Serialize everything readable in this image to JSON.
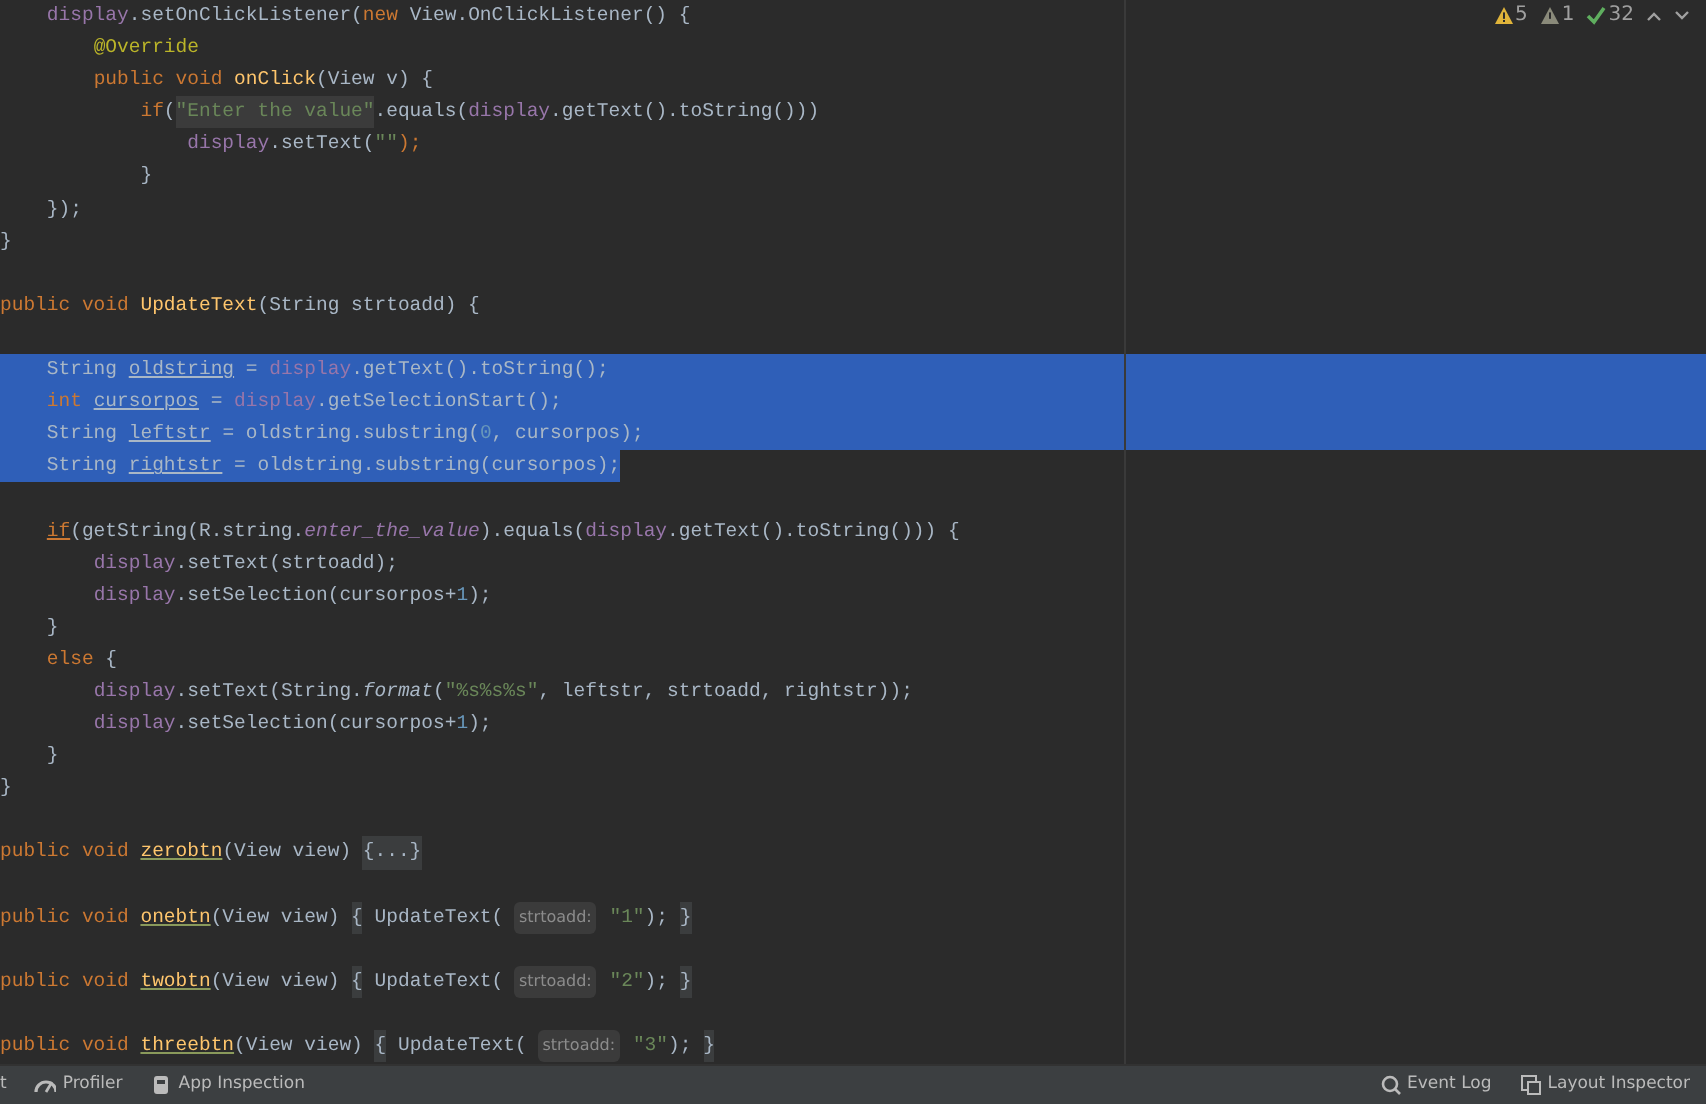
{
  "inspections": [
    {
      "kind": "warning",
      "count": "5"
    },
    {
      "kind": "weak-warning",
      "count": "1"
    },
    {
      "kind": "typo",
      "count": "32"
    }
  ],
  "lines": [
    {
      "selected": false,
      "tokens": [
        {
          "kind": "field",
          "text": "    display"
        },
        {
          "kind": "plain",
          "text": ".setOnClickListener("
        },
        {
          "kind": "keyword",
          "text": "new "
        },
        {
          "kind": "plain",
          "text": "View.OnClickListener() {"
        }
      ]
    },
    {
      "selected": false,
      "tokens": [
        {
          "kind": "annotation",
          "text": "        @Override"
        }
      ]
    },
    {
      "selected": false,
      "tokens": [
        {
          "kind": "keyword",
          "text": "        public void "
        },
        {
          "kind": "method-decl",
          "text": "onClick"
        },
        {
          "kind": "plain",
          "text": "(View v) {"
        }
      ]
    },
    {
      "selected": false,
      "tokens": [
        {
          "kind": "keyword",
          "text": "            if"
        },
        {
          "kind": "plain",
          "text": "("
        },
        {
          "kind": "string-marked",
          "text": "\"Enter the value\""
        },
        {
          "kind": "plain",
          "text": ".equals("
        },
        {
          "kind": "field",
          "text": "display"
        },
        {
          "kind": "plain",
          "text": ".getText().toString()))"
        }
      ]
    },
    {
      "selected": false,
      "tokens": [
        {
          "kind": "field",
          "text": "                display"
        },
        {
          "kind": "plain",
          "text": ".setText("
        },
        {
          "kind": "string",
          "text": "\"\""
        },
        {
          "kind": "punct",
          "text": ");"
        }
      ]
    },
    {
      "selected": false,
      "tokens": [
        {
          "kind": "plain",
          "text": "            }"
        }
      ]
    },
    {
      "selected": false,
      "tokens": [
        {
          "kind": "plain",
          "text": "    });"
        }
      ]
    },
    {
      "selected": false,
      "tokens": [
        {
          "kind": "plain",
          "text": "}"
        }
      ]
    },
    {
      "selected": false
    },
    {
      "selected": false,
      "tokens": [
        {
          "kind": "keyword",
          "text": "public void "
        },
        {
          "kind": "method-decl",
          "text": "UpdateText"
        },
        {
          "kind": "plain",
          "text": "(String strtoadd) {"
        }
      ]
    },
    {
      "selected": false
    },
    {
      "selected": true,
      "tokens": [
        {
          "kind": "plain",
          "text": "    String "
        },
        {
          "kind": "var-decl",
          "text": "oldstring"
        },
        {
          "kind": "plain",
          "text": " = "
        },
        {
          "kind": "field",
          "text": "display"
        },
        {
          "kind": "plain",
          "text": ".getText().toString();"
        }
      ]
    },
    {
      "selected": true,
      "tokens": [
        {
          "kind": "keyword",
          "text": "    int "
        },
        {
          "kind": "var-decl",
          "text": "cursorpos"
        },
        {
          "kind": "plain",
          "text": " = "
        },
        {
          "kind": "field",
          "text": "display"
        },
        {
          "kind": "plain",
          "text": ".getSelectionStart();"
        }
      ]
    },
    {
      "selected": true,
      "tokens": [
        {
          "kind": "plain",
          "text": "    String "
        },
        {
          "kind": "var-decl",
          "text": "leftstr"
        },
        {
          "kind": "plain",
          "text": " = oldstring.substring("
        },
        {
          "kind": "number",
          "text": "0"
        },
        {
          "kind": "plain",
          "text": ", cursorpos);"
        }
      ]
    },
    {
      "selected": true,
      "tokens": [
        {
          "kind": "plain",
          "text": "    String "
        },
        {
          "kind": "var-decl",
          "text": "rightstr"
        },
        {
          "kind": "plain",
          "text": " = oldstring.substring(cursorpos);"
        }
      ]
    },
    {
      "selected": false
    },
    {
      "selected": false,
      "tokens": [
        {
          "kind": "keyword-flagged",
          "text": "    if"
        },
        {
          "kind": "plain",
          "text": "(getString(R.string."
        },
        {
          "kind": "static-field",
          "text": "enter_the_value"
        },
        {
          "kind": "plain",
          "text": ").equals("
        },
        {
          "kind": "field",
          "text": "display"
        },
        {
          "kind": "plain",
          "text": ".getText().toString())) {"
        }
      ]
    },
    {
      "selected": false,
      "tokens": [
        {
          "kind": "field",
          "text": "        display"
        },
        {
          "kind": "plain",
          "text": ".setText(strtoadd);"
        }
      ]
    },
    {
      "selected": false,
      "tokens": [
        {
          "kind": "field",
          "text": "        display"
        },
        {
          "kind": "plain",
          "text": ".setSelection(cursorpos+"
        },
        {
          "kind": "number",
          "text": "1"
        },
        {
          "kind": "plain",
          "text": ");"
        }
      ]
    },
    {
      "selected": false,
      "tokens": [
        {
          "kind": "plain",
          "text": "    }"
        }
      ]
    },
    {
      "selected": false,
      "tokens": [
        {
          "kind": "keyword",
          "text": "    else "
        },
        {
          "kind": "plain",
          "text": "{"
        }
      ]
    },
    {
      "selected": false,
      "tokens": [
        {
          "kind": "field",
          "text": "        display"
        },
        {
          "kind": "plain",
          "text": ".setText(String."
        },
        {
          "kind": "static-method",
          "text": "format"
        },
        {
          "kind": "plain",
          "text": "("
        },
        {
          "kind": "string",
          "text": "\"%s%s%s\""
        },
        {
          "kind": "plain",
          "text": ", leftstr, strtoadd, rightstr));"
        }
      ]
    },
    {
      "selected": false,
      "tokens": [
        {
          "kind": "field",
          "text": "        display"
        },
        {
          "kind": "plain",
          "text": ".setSelection(cursorpos+"
        },
        {
          "kind": "number",
          "text": "1"
        },
        {
          "kind": "plain",
          "text": ");"
        }
      ]
    },
    {
      "selected": false,
      "tokens": [
        {
          "kind": "plain",
          "text": "    }"
        }
      ]
    },
    {
      "selected": false,
      "tokens": [
        {
          "kind": "plain",
          "text": "}"
        }
      ]
    },
    {
      "selected": false
    },
    {
      "selected": false,
      "tokens": [
        {
          "kind": "keyword",
          "text": "public void "
        },
        {
          "kind": "method-flagged",
          "text": "zerobtn"
        },
        {
          "kind": "plain",
          "text": "(View view) "
        },
        {
          "kind": "fold",
          "text": "{...}"
        }
      ]
    },
    {
      "selected": false
    },
    {
      "selected": false,
      "tokens": [
        {
          "kind": "keyword",
          "text": "public void "
        },
        {
          "kind": "method-flagged",
          "text": "onebtn"
        },
        {
          "kind": "plain",
          "text": "(View view) "
        },
        {
          "kind": "fold",
          "text": "{"
        },
        {
          "kind": "plain",
          "text": " UpdateText( "
        },
        {
          "kind": "hint",
          "text": "strtoadd:"
        },
        {
          "kind": "string",
          "text": " \"1\""
        },
        {
          "kind": "plain",
          "text": "); "
        },
        {
          "kind": "fold",
          "text": "}"
        }
      ]
    },
    {
      "selected": false
    },
    {
      "selected": false,
      "tokens": [
        {
          "kind": "keyword",
          "text": "public void "
        },
        {
          "kind": "method-flagged",
          "text": "twobtn"
        },
        {
          "kind": "plain",
          "text": "(View view) "
        },
        {
          "kind": "fold",
          "text": "{"
        },
        {
          "kind": "plain",
          "text": " UpdateText( "
        },
        {
          "kind": "hint",
          "text": "strtoadd:"
        },
        {
          "kind": "string",
          "text": " \"2\""
        },
        {
          "kind": "plain",
          "text": "); "
        },
        {
          "kind": "fold",
          "text": "}"
        }
      ]
    },
    {
      "selected": false
    },
    {
      "selected": false,
      "tokens": [
        {
          "kind": "keyword",
          "text": "public void "
        },
        {
          "kind": "method-flagged",
          "text": "threebtn"
        },
        {
          "kind": "plain",
          "text": "(View view) "
        },
        {
          "kind": "fold",
          "text": "{"
        },
        {
          "kind": "plain",
          "text": " UpdateText( "
        },
        {
          "kind": "hint",
          "text": "strtoadd:"
        },
        {
          "kind": "string",
          "text": " \"3\""
        },
        {
          "kind": "plain",
          "text": "); "
        },
        {
          "kind": "fold",
          "text": "}"
        }
      ]
    }
  ],
  "status_bar": {
    "left": [
      {
        "kind": "cut",
        "label": "t"
      },
      {
        "kind": "profiler",
        "label": "Profiler"
      },
      {
        "kind": "inspection",
        "label": "App Inspection"
      }
    ],
    "right": [
      {
        "kind": "event-log",
        "label": "Event Log"
      },
      {
        "kind": "layout-inspector",
        "label": "Layout Inspector"
      }
    ]
  }
}
